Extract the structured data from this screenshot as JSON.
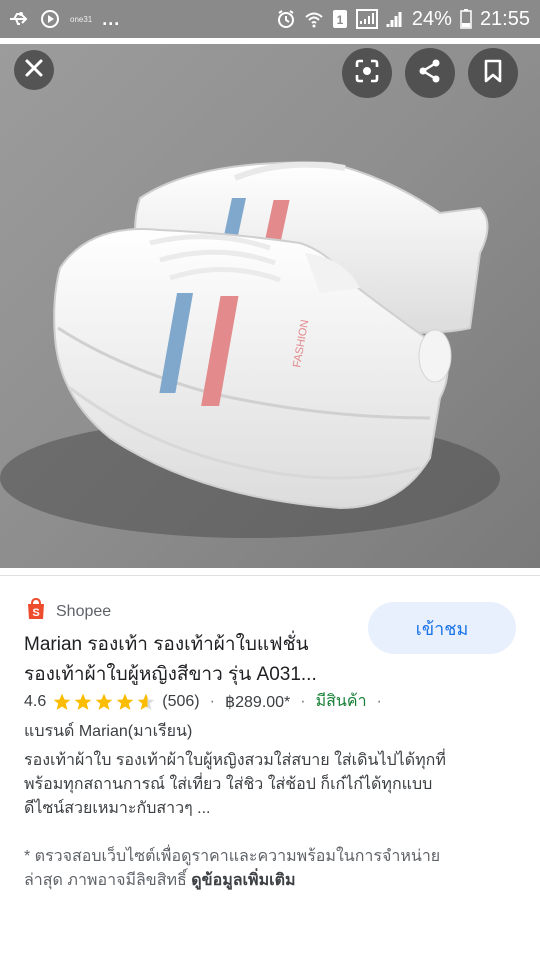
{
  "status_bar": {
    "small_label": "one31",
    "more": "...",
    "battery": "24%",
    "time": "21:55"
  },
  "icons": {
    "close": "close-icon",
    "lens": "lens-icon",
    "share": "share-icon",
    "save": "bookmark-icon"
  },
  "result": {
    "source": "Shopee",
    "visit_label": "เข้าชม",
    "title_line1": "Marian รองเท้า รองเท้าผ้าใบแฟชั่น",
    "title_line2": "รองเท้าผ้าใบผู้หญิงสีขาว รุ่น A031...",
    "rating": "4.6",
    "stars": 4.6,
    "review_count": "(506)",
    "price": "฿289.00*",
    "availability": "มีสินค้า",
    "separator": "·",
    "brand": "แบรนด์ Marian(มาเรียน)",
    "description_line1": "รองเท้าผ้าใบ รองเท้าผ้าใบผู้หญิงสวมใส่สบาย ใส่เดินไปได้ทุกที่",
    "description_line2": "พร้อมทุกสถานการณ์ ใส่เที่ยว ใส่ชิว ใส่ช้อป ก็เก๋ไก๋ได้ทุกแบบ",
    "description_line3": "ดีไซน์สวยเหมาะกับสาวๆ ...",
    "disclaimer_line1": "* ตรวจสอบเว็บไซต์เพื่อดูราคาและความพร้อมในการจำหน่าย",
    "disclaimer_line2": "ล่าสุด ภาพอาจมีลิขสิทธิ์",
    "more_info": "ดูข้อมูลเพิ่มเติม"
  },
  "image": {
    "shoe_print": "FASHION"
  },
  "colors": {
    "accent": "#1a73e8",
    "visit_bg": "#e8f0fe",
    "star": "#fbbc04",
    "in_stock": "#188038",
    "shopee": "#ee4d2d"
  }
}
